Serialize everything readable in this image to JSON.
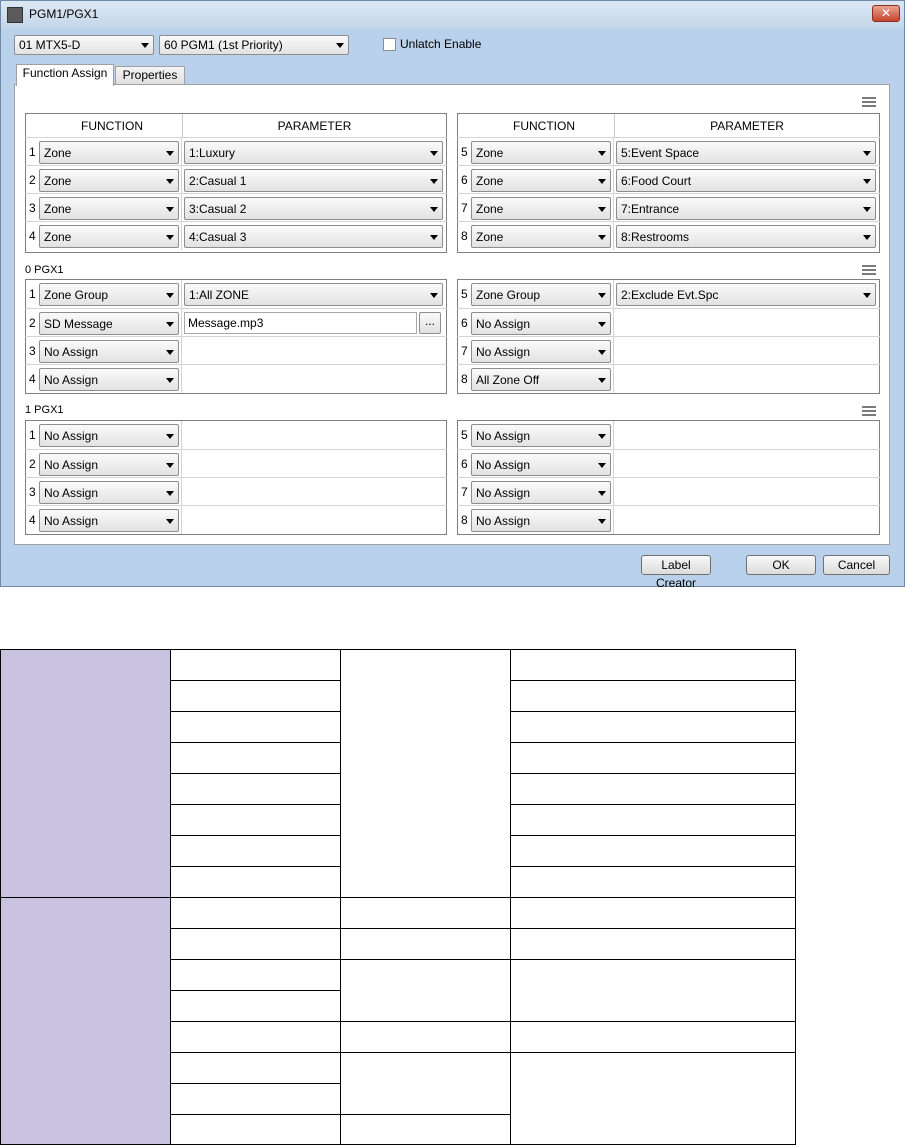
{
  "window": {
    "title": "PGM1/PGX1",
    "close_glyph": "✕"
  },
  "toolbar": {
    "device_select": "01 MTX5-D",
    "pgm_select": "60 PGM1 (1st Priority)",
    "unlatch_label": "Unlatch Enable",
    "unlatch_checked": false
  },
  "tabs": [
    {
      "label": "Function Assign",
      "active": true
    },
    {
      "label": "Properties",
      "active": false
    }
  ],
  "headers": {
    "function": "FUNCTION",
    "parameter": "PARAMETER"
  },
  "pgm": {
    "rows": [
      {
        "num": "1",
        "function": "Zone",
        "parameter": "1:Luxury"
      },
      {
        "num": "2",
        "function": "Zone",
        "parameter": "2:Casual 1"
      },
      {
        "num": "3",
        "function": "Zone",
        "parameter": "3:Casual 2"
      },
      {
        "num": "4",
        "function": "Zone",
        "parameter": "4:Casual 3"
      },
      {
        "num": "5",
        "function": "Zone",
        "parameter": "5:Event Space"
      },
      {
        "num": "6",
        "function": "Zone",
        "parameter": "6:Food Court"
      },
      {
        "num": "7",
        "function": "Zone",
        "parameter": "7:Entrance"
      },
      {
        "num": "8",
        "function": "Zone",
        "parameter": "8:Restrooms"
      }
    ]
  },
  "pgx0": {
    "label": "0 PGX1",
    "rows": [
      {
        "num": "1",
        "function": "Zone Group",
        "parameter": "1:All ZONE"
      },
      {
        "num": "2",
        "function": "SD Message",
        "parameter": "Message.mp3",
        "browse": "..."
      },
      {
        "num": "3",
        "function": "No Assign",
        "parameter": ""
      },
      {
        "num": "4",
        "function": "No Assign",
        "parameter": ""
      },
      {
        "num": "5",
        "function": "Zone Group",
        "parameter": "2:Exclude Evt.Spc"
      },
      {
        "num": "6",
        "function": "No Assign",
        "parameter": ""
      },
      {
        "num": "7",
        "function": "No Assign",
        "parameter": ""
      },
      {
        "num": "8",
        "function": "All Zone Off",
        "parameter": ""
      }
    ]
  },
  "pgx1": {
    "label": "1 PGX1",
    "rows": [
      {
        "num": "1",
        "function": "No Assign",
        "parameter": ""
      },
      {
        "num": "2",
        "function": "No Assign",
        "parameter": ""
      },
      {
        "num": "3",
        "function": "No Assign",
        "parameter": ""
      },
      {
        "num": "4",
        "function": "No Assign",
        "parameter": ""
      },
      {
        "num": "5",
        "function": "No Assign",
        "parameter": ""
      },
      {
        "num": "6",
        "function": "No Assign",
        "parameter": ""
      },
      {
        "num": "7",
        "function": "No Assign",
        "parameter": ""
      },
      {
        "num": "8",
        "function": "No Assign",
        "parameter": ""
      }
    ]
  },
  "footer": {
    "label_creator": "Label Creator",
    "ok": "OK",
    "cancel": "Cancel"
  },
  "colors": {
    "lower_table_accent": "#c8c2e0"
  }
}
